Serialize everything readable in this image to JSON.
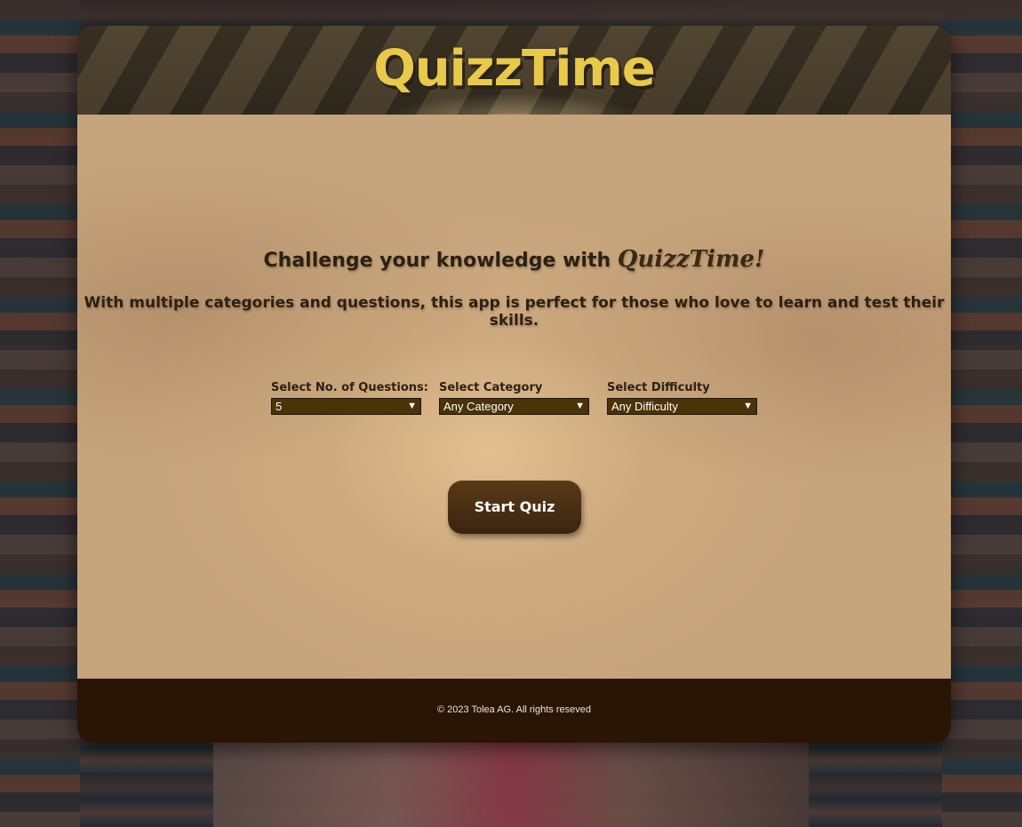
{
  "header": {
    "app_title": "QuizzTime"
  },
  "main": {
    "headline_prefix": "Challenge your knowledge with",
    "headline_brand": "QuizzTime!",
    "tagline": "With multiple categories and questions, this app is perfect for those who love to learn and test their skills."
  },
  "form": {
    "questions": {
      "label": "Select No. of Questions:",
      "selected": "5"
    },
    "category": {
      "label": "Select Category",
      "selected": "Any Category"
    },
    "difficulty": {
      "label": "Select Difficulty",
      "selected": "Any Difficulty"
    }
  },
  "actions": {
    "start_label": "Start Quiz"
  },
  "footer": {
    "copyright": "© 2023 Tolea AG. All rights reseved"
  },
  "icons": {
    "dropdown": "chevron-down-icon"
  },
  "colors": {
    "title_gold": "#e9c94a",
    "panel_tan": "#c6a47c",
    "select_bg": "#4a3306",
    "button_brown": "#4a2f12",
    "footer_brown": "#2a1404"
  }
}
